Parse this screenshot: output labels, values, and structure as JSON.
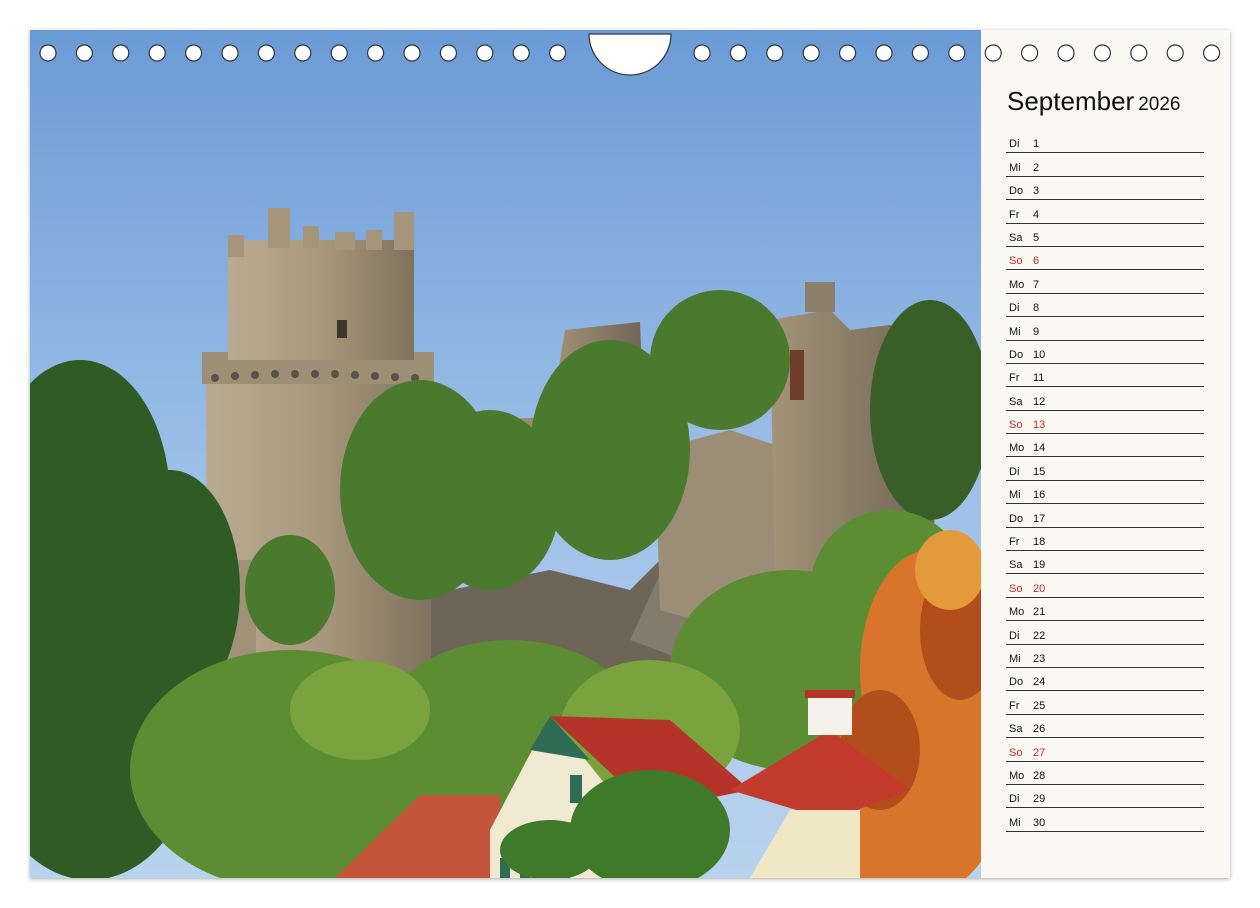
{
  "calendar": {
    "month": "September",
    "year": "2026",
    "days": [
      {
        "wd": "Di",
        "d": "1"
      },
      {
        "wd": "Mi",
        "d": "2"
      },
      {
        "wd": "Do",
        "d": "3"
      },
      {
        "wd": "Fr",
        "d": "4"
      },
      {
        "wd": "Sa",
        "d": "5"
      },
      {
        "wd": "So",
        "d": "6"
      },
      {
        "wd": "Mo",
        "d": "7"
      },
      {
        "wd": "Di",
        "d": "8"
      },
      {
        "wd": "Mi",
        "d": "9"
      },
      {
        "wd": "Do",
        "d": "10"
      },
      {
        "wd": "Fr",
        "d": "11"
      },
      {
        "wd": "Sa",
        "d": "12"
      },
      {
        "wd": "So",
        "d": "13"
      },
      {
        "wd": "Mo",
        "d": "14"
      },
      {
        "wd": "Di",
        "d": "15"
      },
      {
        "wd": "Mi",
        "d": "16"
      },
      {
        "wd": "Do",
        "d": "17"
      },
      {
        "wd": "Fr",
        "d": "18"
      },
      {
        "wd": "Sa",
        "d": "19"
      },
      {
        "wd": "So",
        "d": "20"
      },
      {
        "wd": "Mo",
        "d": "21"
      },
      {
        "wd": "Di",
        "d": "22"
      },
      {
        "wd": "Mi",
        "d": "23"
      },
      {
        "wd": "Do",
        "d": "24"
      },
      {
        "wd": "Fr",
        "d": "25"
      },
      {
        "wd": "Sa",
        "d": "26"
      },
      {
        "wd": "So",
        "d": "27"
      },
      {
        "wd": "Mo",
        "d": "28"
      },
      {
        "wd": "Di",
        "d": "29"
      },
      {
        "wd": "Mi",
        "d": "30"
      }
    ],
    "sunday_color": "#c62828"
  }
}
